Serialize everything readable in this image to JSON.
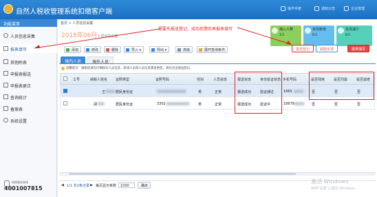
{
  "app": {
    "title": "自然人税收管理系统扣缴客户端"
  },
  "toolbar": {
    "actions": [
      "操作手册",
      "通知公告",
      "企业管理"
    ]
  },
  "sidebar": {
    "header": "功能菜单",
    "items": [
      "人员信息采集",
      "报表填写",
      "其他附表",
      "申报表报送",
      "申报表更正",
      "查询统计",
      "备案表",
      "系统设置"
    ],
    "phone_label": "纳税服务热线",
    "phone": "4001007815"
  },
  "breadcrumb": {
    "home": "首页",
    "current": "人员信息采集"
  },
  "period": {
    "label": "2018年06月",
    "suffix": "人员信息采集"
  },
  "buttons": [
    "添加",
    "修改",
    "删除",
    "导入",
    "导出",
    "高级",
    "展开查询条件"
  ],
  "stats": [
    {
      "title": "纳入人数",
      "value": "2人",
      "color": "#7cc24a"
    },
    {
      "title": "本月新增",
      "value": "0人",
      "color": "#57b5e8"
    },
    {
      "title": "本月减少",
      "value": "0人",
      "color": "#4ccdb3"
    }
  ],
  "actions": {
    "register": "报送登记",
    "feedback": "获取反馈",
    "report": "报表填写"
  },
  "annotation": "需要先报送登记，成功反馈后再报表填写",
  "tabs": [
    "境内人员",
    "境外人员"
  ],
  "warning": "温馨提示：报税前请先仔细核对人员信息，新增人员或人员信息需变更后，请先点击报送登记。",
  "table": {
    "columns": [
      "工号",
      "纳税人姓名",
      "证照类型",
      "证照号码",
      "性别",
      "人员状态",
      "报送状态",
      "身份验证状态",
      "手机号码",
      "是否残疾",
      "是否烈属",
      "是否孤老"
    ],
    "rows": [
      {
        "id": "",
        "name": "王",
        "id_type": "居民身份证",
        "id_no": "",
        "gender": "男",
        "status": "正常",
        "report": "报送成功",
        "verify": "验证通过",
        "phone": "1865",
        "disabled": "否",
        "martyr": "否",
        "lonely": "否"
      },
      {
        "id": "",
        "name": "郑",
        "id_type": "居民身份证",
        "id_no": "3302",
        "gender": "男",
        "status": "正常",
        "report": "报送成功",
        "verify": "验证中",
        "phone": "18678",
        "disabled": "否",
        "martyr": "否",
        "lonely": "否"
      }
    ]
  },
  "pager": {
    "info": "1/1 共2条记录",
    "per_page_label": "每页显示条数",
    "per_page": "1000",
    "confirm": "确定"
  },
  "watermark": {
    "line1": "激活 Windows",
    "line2": "转到\"设置\"以激活 Windows。"
  }
}
